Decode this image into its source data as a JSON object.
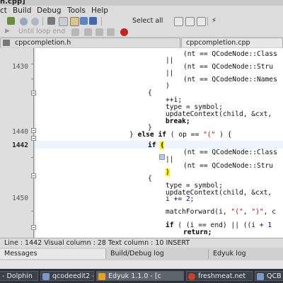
{
  "window": {
    "title": "n.cpp]"
  },
  "menu": {
    "items": [
      "ct",
      "Build",
      "Debug",
      "Tools",
      "Help"
    ]
  },
  "toolbar": {
    "select_all_label": "Select all",
    "until_loop_end_label": "Until loop end"
  },
  "tabs": [
    {
      "label": "cppcompletion.h"
    },
    {
      "label": "cppcompletion.cpp"
    }
  ],
  "editor": {
    "line_numbers": [
      {
        "label": "1430",
        "current": false
      },
      {
        "label": "1440",
        "current": false
      },
      {
        "label": "1442",
        "current": true
      },
      {
        "label": "1450",
        "current": false
      }
    ],
    "lines": [
      "(nt == QCodeNode::Class",
      "||",
      "(nt == QCodeNode::Stru",
      "||",
      "(nt == QCodeNode::Names",
      ")",
      "{",
      "++i;",
      "type = symbol;",
      "updateContext(child, &cxt,",
      "break;",
      "}",
      "} else if ( op == \"(\" ) {",
      "if (",
      "(nt == QCodeNode::Class",
      "||",
      "(nt == QCodeNode::Stru",
      ")",
      "{",
      "type = symbol;",
      "updateContext(child, &cxt,",
      "i += 2;",
      "matchForward(i, \"(\", \")\", c",
      "if ( (i == end) || ((i + 1",
      "return;"
    ]
  },
  "status": {
    "text": "Line : 1442 Visual column : 28 Text column : 10  INSERT"
  },
  "dock_tabs": [
    {
      "label": "Messages"
    },
    {
      "label": "Build/Debug log"
    },
    {
      "label": "Edyuk log"
    }
  ],
  "taskbar": [
    {
      "label": "- Dolphin"
    },
    {
      "label": "qcodeedit2 - Do"
    },
    {
      "label": "Edyuk 1.1.0 - [c"
    },
    {
      "label": "freshmeat.net"
    },
    {
      "label": "QCB"
    }
  ]
}
